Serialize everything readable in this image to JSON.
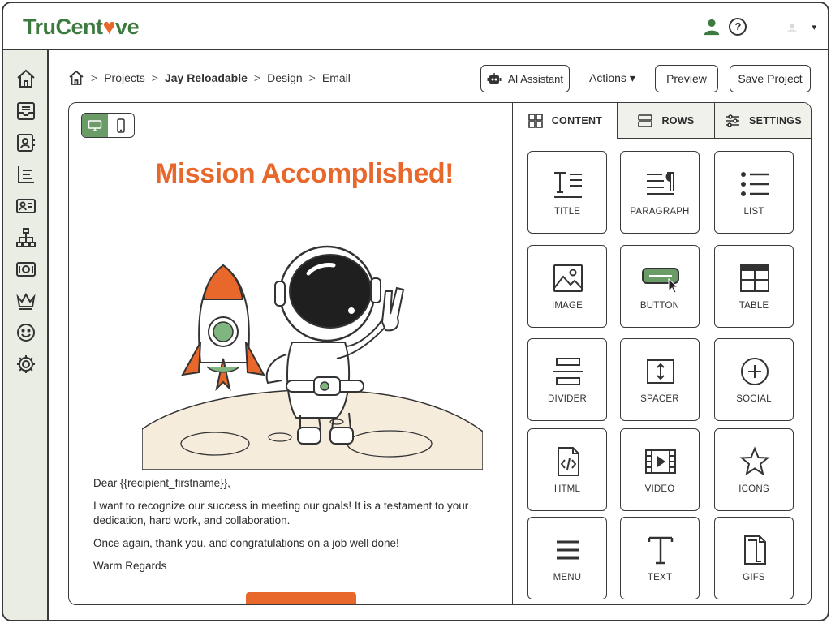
{
  "app": {
    "logo_text_a": "TruCent",
    "logo_heart": "♥",
    "logo_text_b": "ve",
    "help_symbol": "?",
    "caret": "▾"
  },
  "sidebar": {
    "items": [
      {
        "icon": "home-icon"
      },
      {
        "icon": "inbox-icon"
      },
      {
        "icon": "contacts-icon"
      },
      {
        "icon": "list-icon"
      },
      {
        "icon": "id-card-icon"
      },
      {
        "icon": "sitemap-icon"
      },
      {
        "icon": "money-icon"
      },
      {
        "icon": "crown-icon"
      },
      {
        "icon": "smile-icon"
      },
      {
        "icon": "gear-icon"
      }
    ]
  },
  "breadcrumb": {
    "sep": ">",
    "items": [
      "Projects",
      "Jay Reloadable",
      "Design",
      "Email"
    ]
  },
  "toolbar": {
    "ai_label": "AI Assistant",
    "actions_label": "Actions",
    "actions_caret": "▾",
    "preview_label": "Preview",
    "save_label": "Save Project"
  },
  "email": {
    "headline": "Mission Accomplished!",
    "greeting": "Dear {{recipient_firstname}},",
    "paragraph1": "I want to recognize our success in meeting our goals! It is a testament to your dedication, hard work, and collaboration.",
    "paragraph2": "Once again, thank you, and congratulations on a job well done!",
    "closing": "Warm Regards"
  },
  "panel": {
    "tabs": [
      "CONTENT",
      "ROWS",
      "SETTINGS"
    ],
    "blocks": [
      "TITLE",
      "PARAGRAPH",
      "LIST",
      "IMAGE",
      "BUTTON",
      "TABLE",
      "DIVIDER",
      "SPACER",
      "SOCIAL",
      "HTML",
      "VIDEO",
      "ICONS",
      "MENU",
      "TEXT",
      "GIFS"
    ]
  },
  "colors": {
    "brand_green": "#3d7a3f",
    "accent_orange": "#e8672a",
    "sidebar_bg": "#e9ede3",
    "toggle_active": "#6b9b66"
  }
}
